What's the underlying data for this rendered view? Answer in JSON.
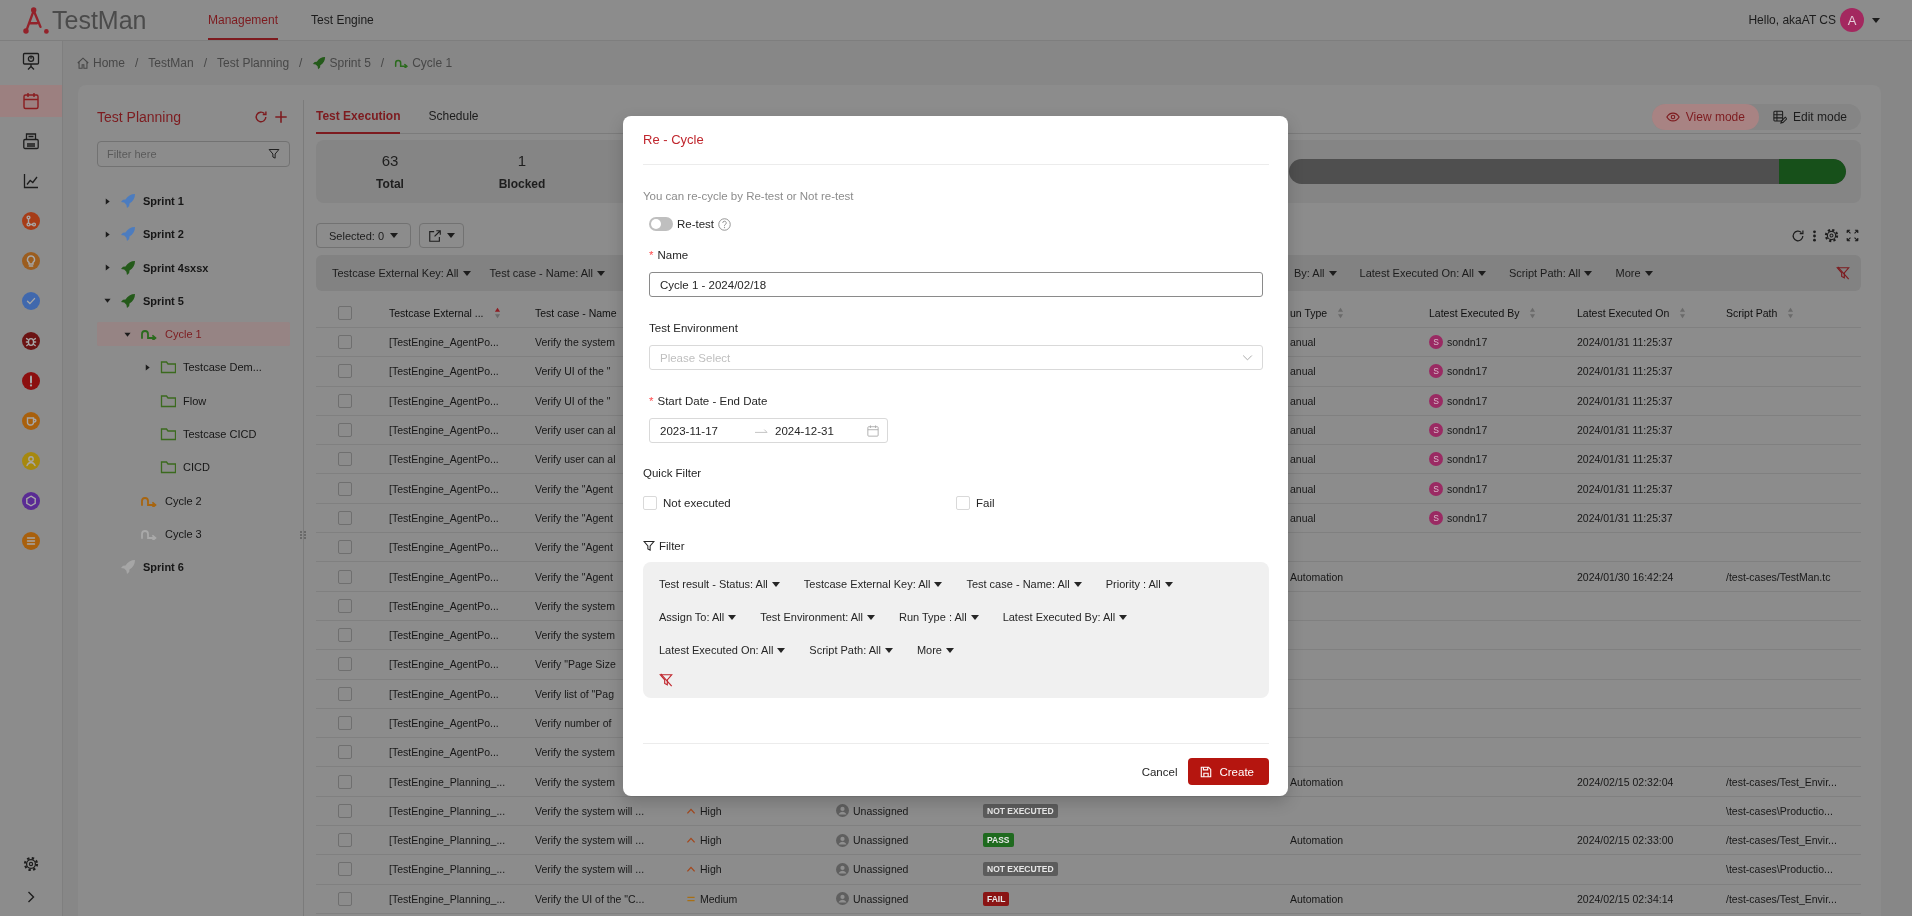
{
  "header": {
    "logo": "TestMan",
    "nav": [
      {
        "label": "Management",
        "selected": true
      },
      {
        "label": "Test Engine",
        "selected": false
      }
    ],
    "greeting": "Hello, akaAT CS",
    "avatar": "A"
  },
  "rail": {
    "items": [
      {
        "selected": false
      },
      {
        "selected": true
      },
      {
        "selected": false
      },
      {
        "selected": false
      },
      {
        "selected": false
      },
      {
        "selected": false
      },
      {
        "selected": false
      },
      {
        "selected": false
      },
      {
        "selected": false
      },
      {
        "selected": false
      },
      {
        "selected": false
      },
      {
        "selected": false
      },
      {
        "selected": false
      }
    ]
  },
  "breadcrumb": {
    "separator": "/",
    "items": [
      {
        "label": "Home",
        "kind": "home"
      },
      {
        "label": "TestMan",
        "kind": "text"
      },
      {
        "label": "Test Planning",
        "kind": "text"
      },
      {
        "label": "Sprint 5",
        "kind": "sprint"
      },
      {
        "label": "Cycle 1",
        "kind": "cycle"
      }
    ]
  },
  "planning": {
    "title": "Test Planning",
    "filter": {
      "placeholder": "Filter here"
    },
    "tree": [
      {
        "label": "Sprint 1",
        "kind": "sprint",
        "color": "#4c7cbf",
        "expanded": false,
        "selected": false
      },
      {
        "label": "Sprint 2",
        "kind": "sprint",
        "color": "#4c7cbf",
        "expanded": false,
        "selected": false
      },
      {
        "label": "Sprint 4sxsx",
        "kind": "sprint",
        "color": "#245a1a",
        "expanded": false,
        "selected": false
      },
      {
        "label": "Sprint 5",
        "kind": "sprint",
        "color": "#245a1a",
        "expanded": true,
        "selected": false,
        "children": [
          {
            "label": "Cycle 1",
            "kind": "cycle",
            "color": "#2b6b1d",
            "expanded": true,
            "selected": true,
            "children": [
              {
                "label": "Testcase Dem...",
                "kind": "folder",
                "expanded": false,
                "selected": false
              },
              {
                "label": "Flow",
                "kind": "folder",
                "selected": false
              },
              {
                "label": "Testcase CICD",
                "kind": "folder",
                "selected": false
              },
              {
                "label": "CICD",
                "kind": "folder",
                "selected": false
              }
            ]
          },
          {
            "label": "Cycle 2",
            "kind": "cycle",
            "color": "#a8650f",
            "selected": false
          },
          {
            "label": "Cycle 3",
            "kind": "cycle",
            "color": "#a9a9a9",
            "selected": false
          }
        ]
      },
      {
        "label": "Sprint 6",
        "kind": "sprint",
        "color": "#a6a6a6",
        "selected": false
      }
    ]
  },
  "execution": {
    "tabs": [
      {
        "label": "Test Execution",
        "selected": true
      },
      {
        "label": "Schedule",
        "selected": false
      }
    ],
    "modes": [
      {
        "label": "View mode",
        "kind": "view",
        "selected": true
      },
      {
        "label": "Edit mode",
        "kind": "edit",
        "selected": false
      }
    ],
    "stats": [
      {
        "value": "63",
        "label": "Total"
      },
      {
        "value": "1",
        "label": "Blocked"
      }
    ],
    "progress": {
      "level": 0.12
    },
    "toolbar": {
      "selection": "Selected: 0"
    },
    "filters": {
      "left": [
        "Testcase External Key: All",
        "Test case - Name: All"
      ],
      "right": [
        "By: All",
        "Latest Executed On: All",
        "Script Path: All",
        "More"
      ]
    },
    "table": {
      "header_checkbox": {
        "checked": false
      },
      "columns": [
        {
          "label": "Testcase External ...",
          "sorted": true
        },
        {
          "label": "Test case - Name"
        },
        {
          "label": "un Type",
          "sorted": false
        },
        {
          "label": "Latest Executed By",
          "sorted": false
        },
        {
          "label": "Latest Executed On",
          "sorted": false
        },
        {
          "label": "Script Path",
          "sorted": false
        }
      ],
      "rows": [
        {
          "checked": false,
          "external_key": "[TestEngine_AgentPo...",
          "test_case_name": "Verify the system",
          "run_type": "anual",
          "executed_by": {
            "initial": "S",
            "name": "sondn17"
          },
          "executed_on": "2024/01/31 11:25:37"
        },
        {
          "checked": false,
          "external_key": "[TestEngine_AgentPo...",
          "test_case_name": "Verify UI of the \"",
          "run_type": "anual",
          "executed_by": {
            "initial": "S",
            "name": "sondn17"
          },
          "executed_on": "2024/01/31 11:25:37"
        },
        {
          "checked": false,
          "external_key": "[TestEngine_AgentPo...",
          "test_case_name": "Verify UI of the \"",
          "run_type": "anual",
          "executed_by": {
            "initial": "S",
            "name": "sondn17"
          },
          "executed_on": "2024/01/31 11:25:37"
        },
        {
          "checked": false,
          "external_key": "[TestEngine_AgentPo...",
          "test_case_name": "Verify user can al",
          "run_type": "anual",
          "executed_by": {
            "initial": "S",
            "name": "sondn17"
          },
          "executed_on": "2024/01/31 11:25:37"
        },
        {
          "checked": false,
          "external_key": "[TestEngine_AgentPo...",
          "test_case_name": "Verify user can al",
          "run_type": "anual",
          "executed_by": {
            "initial": "S",
            "name": "sondn17"
          },
          "executed_on": "2024/01/31 11:25:37"
        },
        {
          "checked": false,
          "external_key": "[TestEngine_AgentPo...",
          "test_case_name": "Verify the \"Agent",
          "run_type": "anual",
          "executed_by": {
            "initial": "S",
            "name": "sondn17"
          },
          "executed_on": "2024/01/31 11:25:37"
        },
        {
          "checked": false,
          "external_key": "[TestEngine_AgentPo...",
          "test_case_name": "Verify the \"Agent",
          "run_type": "anual",
          "executed_by": {
            "initial": "S",
            "name": "sondn17"
          },
          "executed_on": "2024/01/31 11:25:37"
        },
        {
          "checked": false,
          "external_key": "[TestEngine_AgentPo...",
          "test_case_name": "Verify the \"Agent"
        },
        {
          "checked": false,
          "external_key": "[TestEngine_AgentPo...",
          "test_case_name": "Verify the \"Agent",
          "run_type": "Automation",
          "executed_on": "2024/01/30 16:42:24",
          "script_path": "/test-cases/TestMan.tc"
        },
        {
          "checked": false,
          "external_key": "[TestEngine_AgentPo...",
          "test_case_name": "Verify the system"
        },
        {
          "checked": false,
          "external_key": "[TestEngine_AgentPo...",
          "test_case_name": "Verify the system"
        },
        {
          "checked": false,
          "external_key": "[TestEngine_AgentPo...",
          "test_case_name": "Verify \"Page Size"
        },
        {
          "checked": false,
          "external_key": "[TestEngine_AgentPo...",
          "test_case_name": "Verify list of \"Pag"
        },
        {
          "checked": false,
          "external_key": "[TestEngine_AgentPo...",
          "test_case_name": "Verify number of"
        },
        {
          "checked": false,
          "external_key": "[TestEngine_AgentPo...",
          "test_case_name": "Verify the system"
        },
        {
          "checked": false,
          "external_key": "[TestEngine_Planning_...",
          "test_case_name": "Verify the system",
          "run_type": "Automation",
          "executed_on": "2024/02/15 02:32:04",
          "script_path": "/test-cases/Test_Envir..."
        },
        {
          "checked": false,
          "external_key": "[TestEngine_Planning_...",
          "test_case_name": "Verify the system will ...",
          "column_3": {
            "kind": "high",
            "text": "High"
          },
          "column_4": "Unassigned",
          "column_5": {
            "text": "NOT EXECUTED",
            "color": "#5c5c5c"
          },
          "script_path": "\\test-cases\\Productio..."
        },
        {
          "checked": false,
          "external_key": "[TestEngine_Planning_...",
          "test_case_name": "Verify the system will ...",
          "column_3": {
            "kind": "high",
            "text": "High"
          },
          "column_4": "Unassigned",
          "column_5": {
            "text": "PASS",
            "color": "#1f6a1f"
          },
          "run_type": "Automation",
          "executed_on": "2024/02/15 02:33:00",
          "script_path": "/test-cases/Test_Envir..."
        },
        {
          "checked": false,
          "external_key": "[TestEngine_Planning_...",
          "test_case_name": "Verify the system will ...",
          "column_3": {
            "kind": "high",
            "text": "High"
          },
          "column_4": "Unassigned",
          "column_5": {
            "text": "NOT EXECUTED",
            "color": "#5c5c5c"
          },
          "script_path": "\\test-cases\\Productio..."
        },
        {
          "checked": false,
          "external_key": "[TestEngine_Planning_...",
          "test_case_name": "Verify the UI of the \"C...",
          "column_3": {
            "kind": "medium",
            "text": "Medium"
          },
          "column_4": "Unassigned",
          "column_5": {
            "text": "FAIL",
            "color": "#8a1414"
          },
          "run_type": "Automation",
          "executed_on": "2024/02/15 02:34:14",
          "script_path": "/test-cases/Test_Envir..."
        }
      ]
    }
  },
  "modal": {
    "title": "Re - Cycle",
    "hint": "You can re-cycle by Re-test or Not re-test",
    "required_mark": "*",
    "retest": {
      "label": "Re-test",
      "on": false
    },
    "fields": [
      {
        "kind": "text",
        "label": "Name",
        "required": true,
        "value": "Cycle 1 - 2024/02/18"
      },
      {
        "kind": "select",
        "label": "Test Environment",
        "required": false,
        "placeholder": "Please Select"
      },
      {
        "kind": "daterange",
        "label": "Start Date - End Date",
        "required": true,
        "start": "2023-11-17",
        "end": "2024-12-31"
      }
    ],
    "quick_filter": {
      "label": "Quick Filter",
      "options": [
        {
          "label": "Not executed",
          "checked": false
        },
        {
          "label": "Fail",
          "checked": false
        }
      ]
    },
    "filter": {
      "label": "Filter",
      "chips": [
        "Test result - Status: All",
        "Testcase External Key: All",
        "Test case - Name: All",
        "Priority : All",
        "Assign To: All",
        "Test Environment: All",
        "Run Type : All",
        "Latest Executed By: All",
        "Latest Executed On: All",
        "Script Path: All",
        "More"
      ]
    },
    "buttons": [
      {
        "label": "Cancel",
        "kind": "text"
      },
      {
        "label": "Create",
        "kind": "primary"
      }
    ]
  }
}
